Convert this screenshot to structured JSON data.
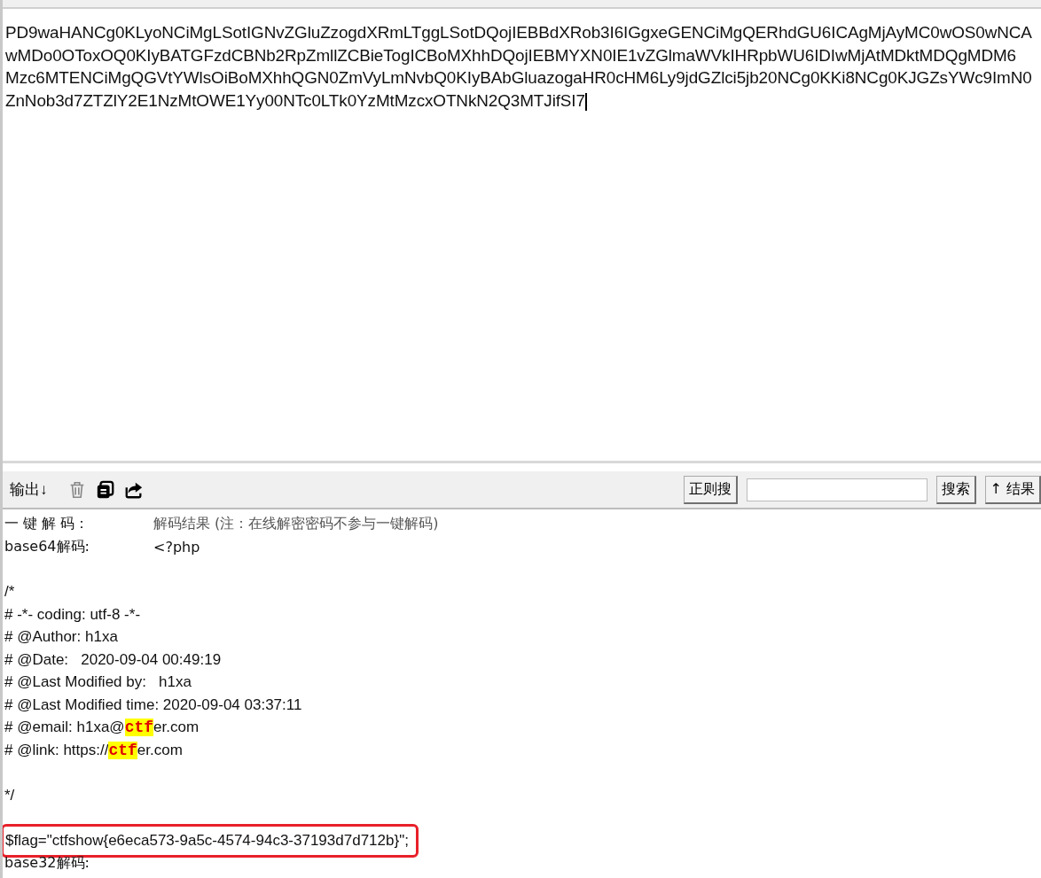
{
  "input": {
    "lines": [
      "PD9waHANCg0KLyoNCiMgLSotIGNvZGluZzogdXRmLTggLSotDQojIEBBdXRob3I6IGgxeGENCiMgQERhdGU6ICAgMjAyMC0wOS0wNCA",
      "wMDo0OToxOQ0KIyBATGFzdCBNb2RpZmllZCBieTogICBoMXhhDQojIEBMYXN0IE1vZGlmaWVkIHRpbWU6IDIwMjAtMDktMDQgMDM6",
      "Mzc6MTENCiMgQGVtYWlsOiBoMXhhQGN0ZmVyLmNvbQ0KIyBAbGluazogaHR0cHM6Ly9jdGZlci5jb20NCg0KKi8NCg0KJGZsYWc9ImN0",
      "ZnNob3d7ZTZlY2E1NzMtOWE1Yy00NTc0LTk0YzMtMzcxOTNkN2Q3MTJifSI7"
    ]
  },
  "toolbar": {
    "output_label": "输出↓",
    "regex_button": "正则搜",
    "search_button": "搜索",
    "results_button": "↑ 结果"
  },
  "output": [
    {
      "kind": "labeled",
      "label": "一 键 解 码：",
      "value": "解码结果 (注：在线解密密码不参与一键解码)",
      "muted": true
    },
    {
      "kind": "labeled",
      "label": "base64解码:",
      "value": "<?php",
      "muted": false
    },
    {
      "kind": "blank"
    },
    {
      "kind": "plain",
      "boxed": false,
      "parts": [
        {
          "text": "/*",
          "highlight": false
        }
      ]
    },
    {
      "kind": "plain",
      "boxed": false,
      "parts": [
        {
          "text": "# -*- coding: utf-8 -*-",
          "highlight": false
        }
      ]
    },
    {
      "kind": "plain",
      "boxed": false,
      "parts": [
        {
          "text": "# @Author: h1xa",
          "highlight": false
        }
      ]
    },
    {
      "kind": "plain",
      "boxed": false,
      "parts": [
        {
          "text": "# @Date:   2020-09-04 00:49:19",
          "highlight": false
        }
      ]
    },
    {
      "kind": "plain",
      "boxed": false,
      "parts": [
        {
          "text": "# @Last Modified by:   h1xa",
          "highlight": false
        }
      ]
    },
    {
      "kind": "plain",
      "boxed": false,
      "parts": [
        {
          "text": "# @Last Modified time: 2020-09-04 03:37:11",
          "highlight": false
        }
      ]
    },
    {
      "kind": "plain",
      "boxed": false,
      "parts": [
        {
          "text": "# @email: h1xa@",
          "highlight": false
        },
        {
          "text": "ctf",
          "highlight": true
        },
        {
          "text": "er.com",
          "highlight": false
        }
      ]
    },
    {
      "kind": "plain",
      "boxed": false,
      "parts": [
        {
          "text": "# @link: https://",
          "highlight": false
        },
        {
          "text": "ctf",
          "highlight": true
        },
        {
          "text": "er.com",
          "highlight": false
        }
      ]
    },
    {
      "kind": "blank"
    },
    {
      "kind": "plain",
      "boxed": false,
      "parts": [
        {
          "text": "*/",
          "highlight": false
        }
      ]
    },
    {
      "kind": "blank"
    },
    {
      "kind": "plain",
      "boxed": true,
      "parts": [
        {
          "text": "$flag=\"ctfshow{e6eca573-9a5c-4574-94c3-37193d7d712b}\";",
          "highlight": false
        }
      ]
    },
    {
      "kind": "labeled",
      "label": "base32解码:"
    }
  ]
}
